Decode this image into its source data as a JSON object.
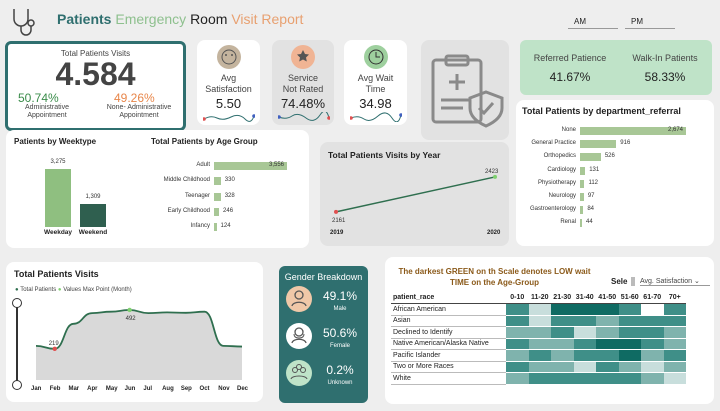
{
  "header": {
    "title_word1": "Patients",
    "title_word2": "Emergency",
    "title_word3": "Room",
    "title_word4": "Visit Report",
    "ampm": [
      "AM",
      "PM"
    ]
  },
  "total_visits": {
    "label": "Total Patients Visits",
    "value": "4.584",
    "admin_pct": "50.74%",
    "admin_label": "Administrative\nAppointment",
    "nonadmin_pct": "49.26%",
    "nonadmin_label": "None- Administrative\nAppointment"
  },
  "kpis": [
    {
      "name": "Avg\nSatisfaction",
      "value": "5.50",
      "icon": "satisfaction-icon"
    },
    {
      "name": "Service\nNot Rated",
      "value": "74.48%",
      "icon": "rating-icon"
    },
    {
      "name": "Avg Wait\nTime",
      "value": "34.98",
      "icon": "clock-icon"
    }
  ],
  "referral": {
    "referred_label": "Referred Patience",
    "referred_value": "41.67%",
    "walkin_label": "Walk-In Patients",
    "walkin_value": "58.33%"
  },
  "dept": {
    "title": "Total Patients by department_referral",
    "items": [
      {
        "label": "None",
        "value": 2674
      },
      {
        "label": "General Practice",
        "value": 916
      },
      {
        "label": "Orthopedics",
        "value": 526
      },
      {
        "label": "Cardiology",
        "value": 131
      },
      {
        "label": "Physiotherapy",
        "value": 112
      },
      {
        "label": "Neurology",
        "value": 97
      },
      {
        "label": "Gastroenterology",
        "value": 84
      },
      {
        "label": "Renal",
        "value": 44
      }
    ]
  },
  "weektype": {
    "title": "Patients by Weektype",
    "items": [
      {
        "label": "Weekday",
        "value": 3275,
        "display": "3,275"
      },
      {
        "label": "Weekend",
        "value": 1309,
        "display": "1,309"
      }
    ]
  },
  "agegroup": {
    "title": "Total Patients by Age Group",
    "items": [
      {
        "label": "Adult",
        "value": 3556,
        "display": "3,556"
      },
      {
        "label": "Middle Childhood",
        "value": 330,
        "display": "330"
      },
      {
        "label": "Teenager",
        "value": 328,
        "display": "328"
      },
      {
        "label": "Early Childhood",
        "value": 246,
        "display": "246"
      },
      {
        "label": "Infancy",
        "value": 124,
        "display": "124"
      }
    ]
  },
  "byyear": {
    "title": "Total Patients Visits by Year",
    "years": [
      "2019",
      "2020"
    ],
    "values": [
      2161,
      2423
    ]
  },
  "monthly": {
    "title": "Total Patients Visits",
    "legend": [
      "Total Patients",
      "Values Max Point (Month)"
    ],
    "months": [
      "Jan",
      "Feb",
      "Mar",
      "Apr",
      "May",
      "Jun",
      "Jul",
      "Aug",
      "Sep",
      "Oct",
      "Nov",
      "Dec"
    ],
    "values": [
      240,
      219,
      395,
      470,
      480,
      492,
      470,
      475,
      472,
      480,
      240,
      235
    ],
    "max_label": "492",
    "min_label": "219"
  },
  "gender": {
    "title": "Gender Breakdown",
    "items": [
      {
        "pct": "49.1%",
        "label": "Male",
        "icon": "male-icon"
      },
      {
        "pct": "50.6%",
        "label": "Female",
        "icon": "female-icon"
      },
      {
        "pct": "0.2%",
        "label": "Unknown",
        "icon": "group-icon"
      }
    ]
  },
  "heatmap": {
    "note": "The darkest GREEN on th Scale denotes LOW wait TIME on the Age-Group",
    "select_label": "Sele",
    "select_value": "Avg. Satisfaction",
    "col_header": "patient_race",
    "ages": [
      "0-10",
      "11-20",
      "21-30",
      "31-40",
      "41-50",
      "51-60",
      "61-70",
      "70+"
    ],
    "rows": [
      "African American",
      "Asian",
      "Declined to Identify",
      "Native American/Alaska Native",
      "Pacific Islander",
      "Two or More Races",
      "White"
    ],
    "levels": [
      [
        3,
        1,
        4,
        4,
        4,
        3,
        0,
        3
      ],
      [
        3,
        1,
        3,
        3,
        2,
        3,
        3,
        3
      ],
      [
        2,
        2,
        3,
        1,
        2,
        3,
        3,
        2
      ],
      [
        3,
        2,
        2,
        3,
        4,
        4,
        3,
        2
      ],
      [
        2,
        3,
        2,
        3,
        3,
        4,
        2,
        3
      ],
      [
        3,
        2,
        2,
        1,
        3,
        2,
        1,
        2
      ],
      [
        2,
        3,
        3,
        3,
        3,
        3,
        2,
        1
      ]
    ]
  },
  "colors": {
    "teal": "#2f6f6f",
    "green": "#3a8c4a",
    "light_green": "#a8c796",
    "orange": "#e8864a",
    "accent_bg": "#bfe3c8"
  }
}
